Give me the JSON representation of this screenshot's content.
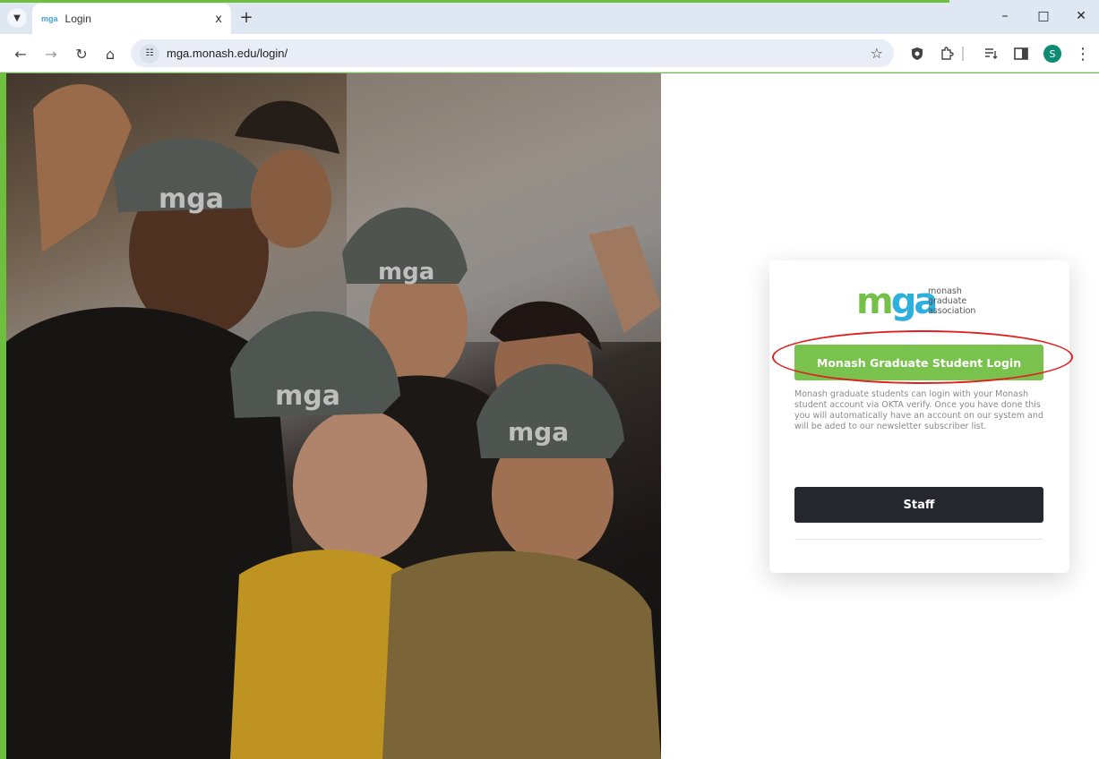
{
  "browser": {
    "tab_list_icon": "chevron-down-icon",
    "tab": {
      "favicon": "mga",
      "title": "Login",
      "close": "x"
    },
    "new_tab": "+",
    "window_controls": {
      "minimize": "–",
      "maximize": "□",
      "close": "✕"
    },
    "nav": {
      "back": "←",
      "forward": "→",
      "reload": "↻",
      "home": "⌂"
    },
    "url": "mga.monash.edu/login/",
    "site_info_icon": "☷",
    "bookmark_icon": "☆",
    "extension_icons": [
      "shield-icon",
      "puzzle-icon",
      "reading-list-icon",
      "side-panel-icon"
    ],
    "profile_initial": "S",
    "menu": "⋮"
  },
  "login_card": {
    "logo": {
      "mark_m": "m",
      "mark_ga": "ga",
      "line1": "monash",
      "line2": "graduate",
      "line3": "association"
    },
    "primary_button": "Monash Graduate Student Login",
    "description": "Monash graduate students can login with your Monash student account via OKTA verify. Once you have done this you will automatically have an account on our system and will be aded to our newsletter subscriber list.",
    "staff_button": "Staff"
  },
  "colors": {
    "accent_green": "#79c24d",
    "accent_blue": "#2eb0df",
    "staff_dark": "#26262e",
    "annotation_red": "#e02020"
  }
}
